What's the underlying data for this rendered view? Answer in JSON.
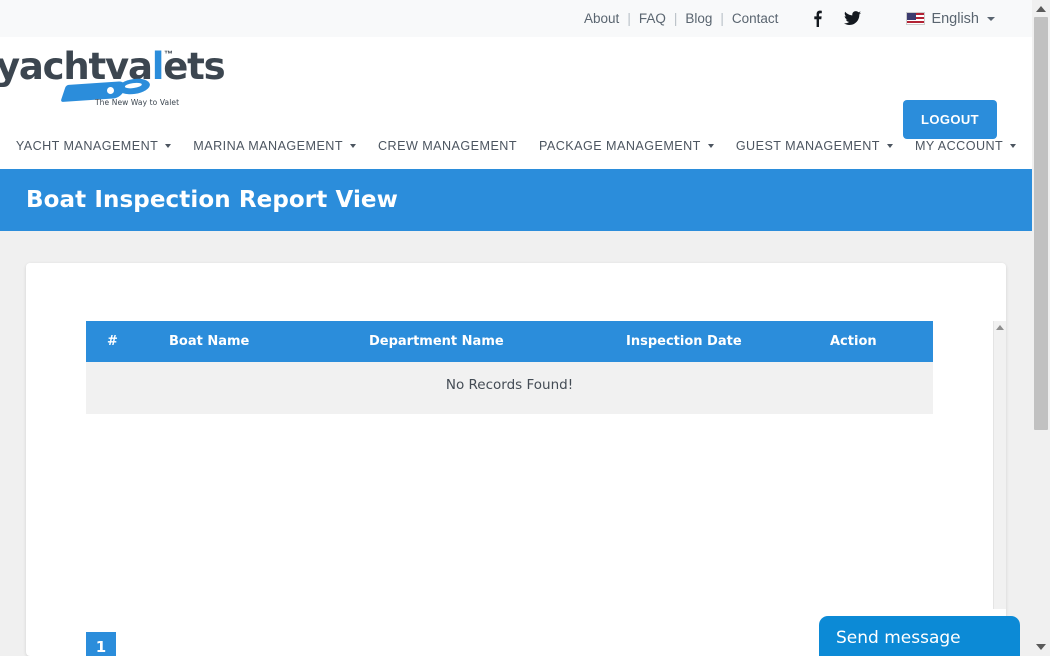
{
  "topbar": {
    "links": [
      {
        "label": "About"
      },
      {
        "label": "FAQ"
      },
      {
        "label": "Blog"
      },
      {
        "label": "Contact"
      }
    ],
    "separator": "|",
    "social": [
      {
        "name": "facebook-icon"
      },
      {
        "name": "twitter-icon"
      }
    ],
    "language": {
      "label": "English",
      "flag": "us-flag-icon"
    }
  },
  "header": {
    "logo": {
      "text_part1": "yachtva",
      "text_part2": "l",
      "text_part3": "ets",
      "trademark": "™",
      "tagline": "The New Way to Valet"
    },
    "logout_label": "LOGOUT"
  },
  "nav": {
    "items": [
      {
        "label": "YACHT MANAGEMENT",
        "has_dropdown": true
      },
      {
        "label": "MARINA MANAGEMENT",
        "has_dropdown": true
      },
      {
        "label": "CREW MANAGEMENT",
        "has_dropdown": false
      },
      {
        "label": "PACKAGE MANAGEMENT",
        "has_dropdown": true
      },
      {
        "label": "GUEST MANAGEMENT",
        "has_dropdown": true
      },
      {
        "label": "MY ACCOUNT",
        "has_dropdown": true
      }
    ]
  },
  "banner": {
    "title": "Boat Inspection Report View"
  },
  "table": {
    "columns": [
      {
        "label": "#"
      },
      {
        "label": "Boat Name"
      },
      {
        "label": "Department Name"
      },
      {
        "label": "Inspection Date"
      },
      {
        "label": "Action"
      }
    ],
    "rows": [],
    "empty_message": "No Records Found!"
  },
  "pagination": {
    "pages": [
      {
        "label": "1",
        "active": true
      }
    ]
  },
  "chat": {
    "button_label": "Send message"
  },
  "colors": {
    "accent_blue": "#2b8ddb",
    "chat_blue": "#0c8ad6",
    "topbar_bg": "#f8f9fa",
    "page_bg": "#f0f0f0",
    "empty_row_bg": "#f1f1f1",
    "nav_text": "#4c5560"
  }
}
